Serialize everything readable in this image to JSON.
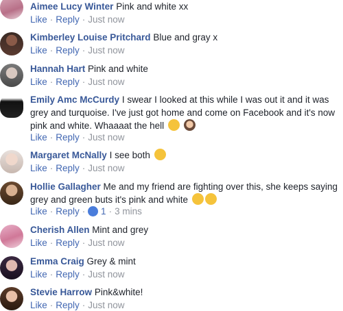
{
  "actions": {
    "like": "Like",
    "reply": "Reply",
    "sep": "·"
  },
  "comments": [
    {
      "author": "Aimee Lucy Winter",
      "text": "Pink and white xx",
      "time": "Just now"
    },
    {
      "author": "Kimberley Louise Pritchard",
      "text": "Blue and gray x",
      "time": "Just now"
    },
    {
      "author": "Hannah Hart",
      "text": "Pink and white",
      "time": "Just now"
    },
    {
      "author": "Emily Amc McCurdy",
      "text": "I swear I looked at this while I was out it and it was grey and turquoise. I've just got home and come on Facebook and it's now pink and white. Whaaaat the hell",
      "time": "Just now",
      "emojis": [
        "tired-face-emoji",
        "woman-facepalm-emoji"
      ]
    },
    {
      "author": "Margaret McNally",
      "text": "I see both",
      "time": "Just now",
      "emojis": [
        "laughing-tears-emoji"
      ]
    },
    {
      "author": "Hollie Gallagher",
      "text": "Me and my friend are fighting over this, she keeps saying grey and green buts it's pink and white",
      "time": "3 mins",
      "reaction_count": "1",
      "emojis": [
        "crying-face-emoji",
        "crying-face-emoji"
      ]
    },
    {
      "author": "Cherish Allen",
      "text": "Mint and grey",
      "time": "Just now"
    },
    {
      "author": "Emma Craig",
      "text": "Grey & mint",
      "time": "Just now"
    },
    {
      "author": "Stevie Harrow",
      "text": "Pink&white!",
      "time": "Just now"
    }
  ],
  "colors": {
    "author": "#385898",
    "link": "#4267b2",
    "meta": "#90949c",
    "like_badge": "#4a7ddb"
  }
}
